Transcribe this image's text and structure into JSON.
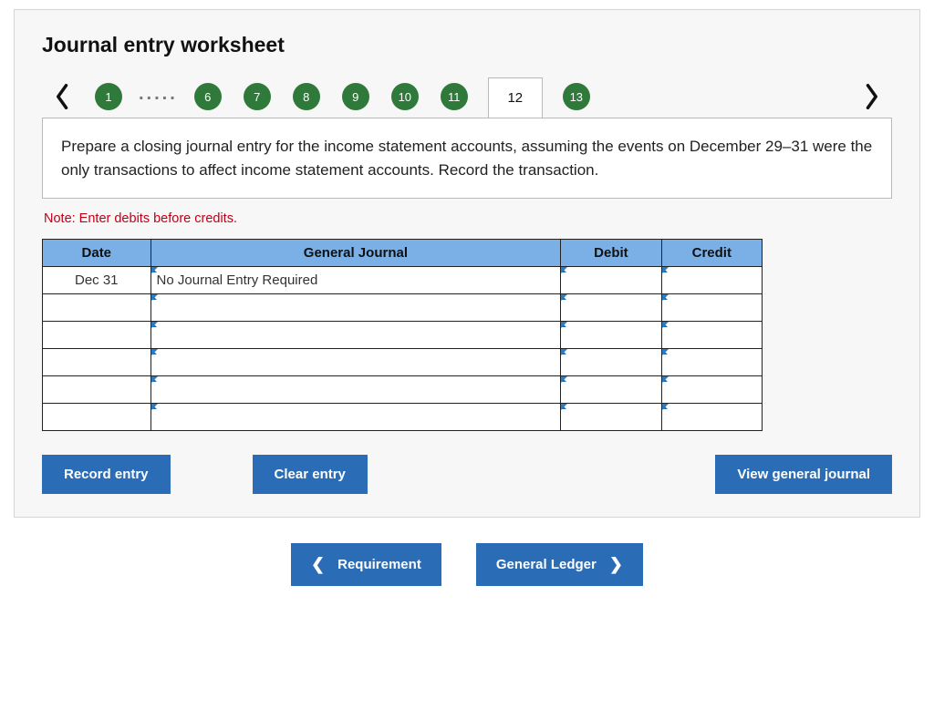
{
  "title": "Journal entry worksheet",
  "pager": {
    "first": "1",
    "ellipsis": ".....",
    "nums": [
      "6",
      "7",
      "8",
      "9",
      "10",
      "11"
    ],
    "current": "12",
    "after": [
      "13"
    ]
  },
  "prompt": "Prepare a closing journal entry for the income statement accounts, assuming the events on December 29–31 were the only transactions to affect income statement accounts. Record the transaction.",
  "note": "Note: Enter debits before credits.",
  "table": {
    "headers": {
      "date": "Date",
      "gj": "General Journal",
      "debit": "Debit",
      "credit": "Credit"
    },
    "rows": [
      {
        "date": "Dec 31",
        "gj": "No Journal Entry Required",
        "debit": "",
        "credit": ""
      },
      {
        "date": "",
        "gj": "",
        "debit": "",
        "credit": ""
      },
      {
        "date": "",
        "gj": "",
        "debit": "",
        "credit": ""
      },
      {
        "date": "",
        "gj": "",
        "debit": "",
        "credit": ""
      },
      {
        "date": "",
        "gj": "",
        "debit": "",
        "credit": ""
      },
      {
        "date": "",
        "gj": "",
        "debit": "",
        "credit": ""
      }
    ]
  },
  "buttons": {
    "record": "Record entry",
    "clear": "Clear entry",
    "view": "View general journal"
  },
  "footer": {
    "prev": "Requirement",
    "next": "General Ledger"
  }
}
